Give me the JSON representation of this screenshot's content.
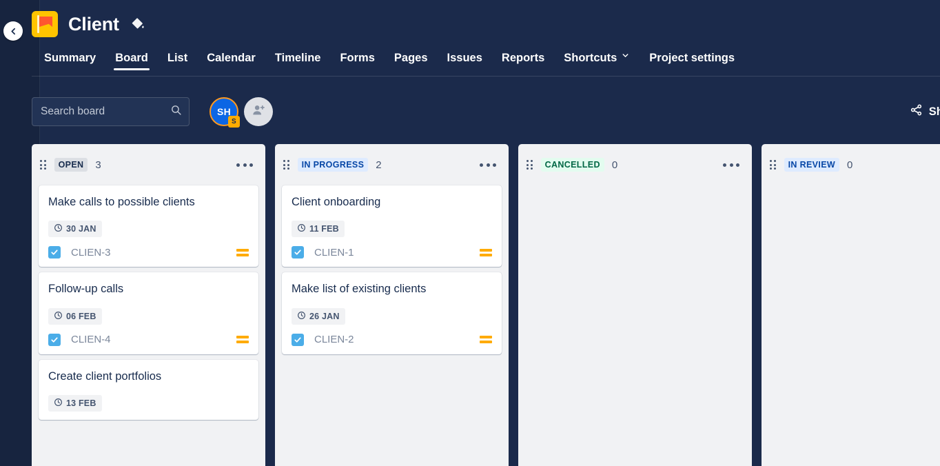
{
  "header": {
    "back_icon": "chevron-left-icon",
    "logo_icon": "project-flag-logo",
    "project_title": "Client",
    "paint_icon": "paint-bucket-icon",
    "tabs": [
      {
        "label": "Summary",
        "active": false,
        "has_chevron": false
      },
      {
        "label": "Board",
        "active": true,
        "has_chevron": false
      },
      {
        "label": "List",
        "active": false,
        "has_chevron": false
      },
      {
        "label": "Calendar",
        "active": false,
        "has_chevron": false
      },
      {
        "label": "Timeline",
        "active": false,
        "has_chevron": false
      },
      {
        "label": "Forms",
        "active": false,
        "has_chevron": false
      },
      {
        "label": "Pages",
        "active": false,
        "has_chevron": false
      },
      {
        "label": "Issues",
        "active": false,
        "has_chevron": false
      },
      {
        "label": "Reports",
        "active": false,
        "has_chevron": false
      },
      {
        "label": "Shortcuts",
        "active": false,
        "has_chevron": true
      },
      {
        "label": "Project settings",
        "active": false,
        "has_chevron": false
      }
    ]
  },
  "toolbar": {
    "search_placeholder": "Search board",
    "search_value": "",
    "search_icon": "search-icon",
    "avatar": {
      "initials": "SH",
      "badge": "S"
    },
    "add_person_icon": "add-person-icon",
    "share_label": "Sha",
    "share_icon": "share-icon"
  },
  "columns": [
    {
      "status": "OPEN",
      "count": "3",
      "badge_bg": "#DCDFE4",
      "badge_color": "#172B4D",
      "has_menu": true,
      "cards": [
        {
          "title": "Make calls to possible clients",
          "date": "30 JAN",
          "key": "CLIEN-3",
          "type_icon": "task-checkbox-icon",
          "priority_icon": "priority-medium-icon"
        },
        {
          "title": "Follow-up calls",
          "date": "06 FEB",
          "key": "CLIEN-4",
          "type_icon": "task-checkbox-icon",
          "priority_icon": "priority-medium-icon"
        },
        {
          "title": "Create client portfolios",
          "date": "13 FEB",
          "key": "",
          "type_icon": "",
          "priority_icon": ""
        }
      ]
    },
    {
      "status": "IN PROGRESS",
      "count": "2",
      "badge_bg": "#DEEBFF",
      "badge_color": "#0747A6",
      "has_menu": true,
      "cards": [
        {
          "title": "Client onboarding",
          "date": "11 FEB",
          "key": "CLIEN-1",
          "type_icon": "task-checkbox-icon",
          "priority_icon": "priority-medium-icon"
        },
        {
          "title": "Make list of existing clients",
          "date": "26 JAN",
          "key": "CLIEN-2",
          "type_icon": "task-checkbox-icon",
          "priority_icon": "priority-medium-icon"
        }
      ]
    },
    {
      "status": "CANCELLED",
      "count": "0",
      "badge_bg": "#E3FCEF",
      "badge_color": "#006644",
      "has_menu": true,
      "cards": []
    },
    {
      "status": "IN REVIEW",
      "count": "0",
      "badge_bg": "#DEEBFF",
      "badge_color": "#0747A6",
      "has_menu": false,
      "cards": []
    }
  ]
}
